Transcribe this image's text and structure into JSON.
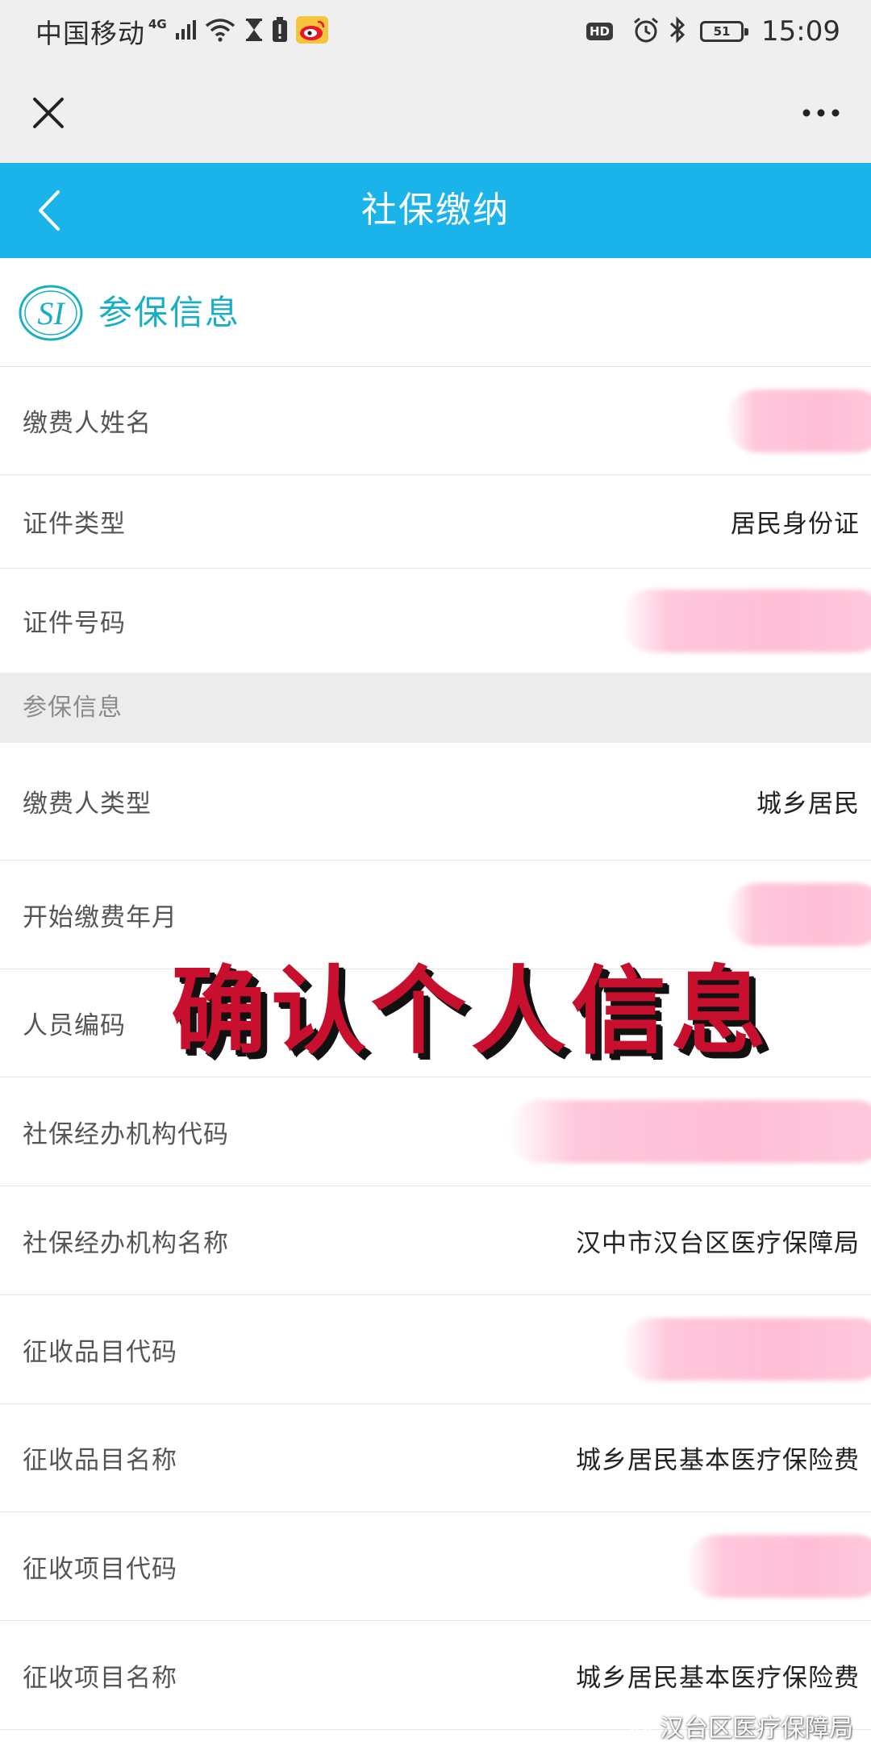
{
  "status_bar": {
    "carrier": "中国移动",
    "network": "4G",
    "hd": "HD",
    "battery": "51",
    "time": "15:09",
    "icons": [
      "signal-icon",
      "wifi-icon",
      "hourglass-icon",
      "battery-alert-icon",
      "weibo-icon",
      "alarm-icon",
      "bluetooth-icon"
    ]
  },
  "browser_bar": {
    "icons": [
      "close-icon",
      "more-icon"
    ]
  },
  "header": {
    "title": "社保缴纳",
    "color": "#1ab3ea"
  },
  "section": {
    "title": "参保信息",
    "logo_text": "SI"
  },
  "person": {
    "rows": [
      {
        "label": "缴费人姓名",
        "value": ""
      },
      {
        "label": "证件类型",
        "value": "居民身份证"
      },
      {
        "label": "证件号码",
        "value": ""
      }
    ]
  },
  "insurance": {
    "group_label": "参保信息",
    "rows": [
      {
        "label": "缴费人类型",
        "value": "城乡居民"
      },
      {
        "label": "开始缴费年月",
        "value": ""
      },
      {
        "label": "人员编码",
        "value": ""
      },
      {
        "label": "社保经办机构代码",
        "value": ""
      },
      {
        "label": "社保经办机构名称",
        "value": "汉中市汉台区医疗保障局"
      },
      {
        "label": "征收品目代码",
        "value": ""
      },
      {
        "label": "征收品目名称",
        "value": "城乡居民基本医疗保险费"
      },
      {
        "label": "征收项目代码",
        "value": ""
      },
      {
        "label": "征收项目名称",
        "value": "城乡居民基本医疗保险费"
      }
    ]
  },
  "overlay": {
    "caption": "确认个人信息",
    "color": "#c8102e"
  },
  "watermark": {
    "text": "汉台区医疗保障局"
  }
}
